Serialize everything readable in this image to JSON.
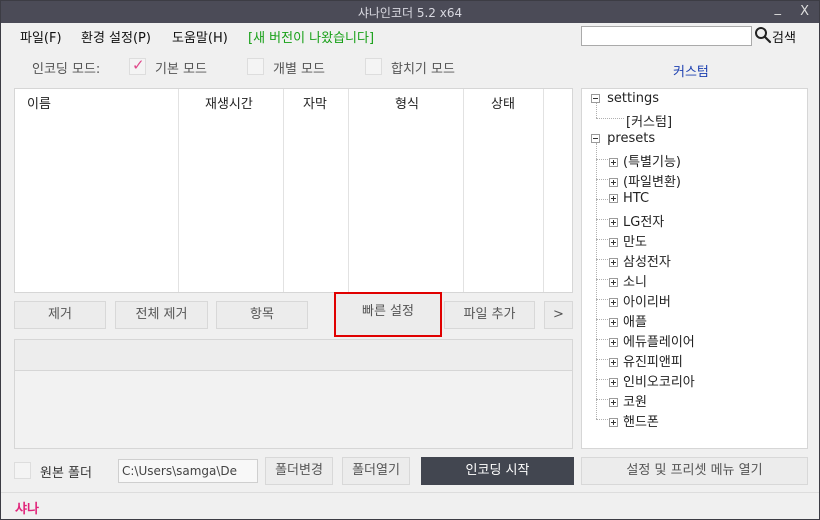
{
  "window": {
    "title": "샤나인코더  5.2  x64",
    "minimize_glyph": "_",
    "close_glyph": "X"
  },
  "menu": {
    "file": "파일(F)",
    "settings": "환경 설정(P)",
    "help": "도움말(H)",
    "update_notice": "[새 버전이 나왔습니다]"
  },
  "search": {
    "value": "",
    "placeholder": "",
    "label": "검색"
  },
  "encoding_mode": {
    "label": "인코딩 모드:",
    "basic": "기본 모드",
    "individual": "개별 모드",
    "merge": "합치기 모드",
    "selected": "basic"
  },
  "custom_link": "커스텀",
  "file_list": {
    "columns": [
      "이름",
      "재생시간",
      "자막",
      "형식",
      "상태"
    ],
    "rows": []
  },
  "buttons": {
    "remove": "제거",
    "remove_all": "전체 제거",
    "items": "항목",
    "quick_settings": "빠른 설정",
    "add_file": "파일 추가",
    "more": ">",
    "change_folder": "폴더변경",
    "open_folder": "폴더열기",
    "start_encoding": "인코딩 시작",
    "open_settings_menu": "설정 및 프리셋 메뉴 열기"
  },
  "tree": {
    "settings": {
      "label": "settings",
      "children": [
        "[커스텀]"
      ]
    },
    "presets": {
      "label": "presets",
      "children": [
        "(특별기능)",
        "(파일변환)",
        "HTC",
        "LG전자",
        "만도",
        "삼성전자",
        "소니",
        "아이리버",
        "애플",
        "에듀플레이어",
        "유진피앤피",
        "인비오코리아",
        "코원",
        "핸드폰"
      ]
    }
  },
  "output": {
    "source_folder_label": "원본 폴더",
    "source_folder_checked": false,
    "path": "C:\\Users\\samga\\De"
  },
  "status": {
    "text": "샤나"
  },
  "colors": {
    "titlebar": "#4b4b57",
    "accent_pink": "#e0247a",
    "update_green": "#18a018",
    "link_blue": "#1b3fb0",
    "highlight_red": "#e00000",
    "start_button": "#424650"
  }
}
